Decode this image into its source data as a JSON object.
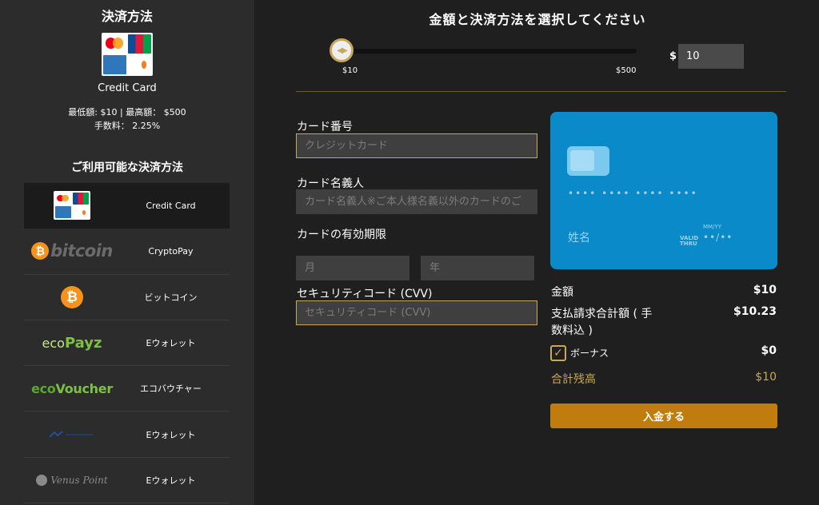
{
  "sidebar": {
    "title": "決済方法",
    "selected_name": "Credit Card",
    "limits": "最低額: $10 | 最高額： $500",
    "fee": "手数料： 2.25%",
    "available_title": "ご利用可能な決済方法",
    "methods": [
      {
        "label": "Credit Card",
        "logo": "credit-card-logos"
      },
      {
        "label": "CryptoPay",
        "logo": "bitcoin-wordmark"
      },
      {
        "label": "ビットコイン",
        "logo": "bitcoin-icon"
      },
      {
        "label": "Eウォレット",
        "logo": "ecopayz-logo",
        "logo_text": "ecoPayz"
      },
      {
        "label": "エコバウチャー",
        "logo": "ecovoucher-logo",
        "logo_text": "ecoVoucher"
      },
      {
        "label": "Eウォレット",
        "logo": "wallet-logo"
      },
      {
        "label": "Eウォレット",
        "logo": "venuspoint-logo",
        "logo_text": "Venus Point"
      }
    ]
  },
  "main": {
    "title": "金額と決済方法を選択してください",
    "slider": {
      "min_label": "$10",
      "max_label": "$500",
      "value_fraction": 0.0
    },
    "amount": {
      "currency": "$",
      "value": "10"
    }
  },
  "form": {
    "card_number_label": "カード番号",
    "card_number_placeholder": "クレジットカード",
    "card_holder_label": "カード名義人",
    "card_holder_placeholder": "カード名義人※ご本人様名義以外のカードのご",
    "expiry_label": "カードの有効期限",
    "month_placeholder": "月",
    "year_placeholder": "年",
    "cvv_label": "セキュリティコード (CVV)",
    "cvv_placeholder": "セキュリティコード (CVV)"
  },
  "card_preview": {
    "number": "•••• •••• •••• ••••",
    "name": "姓名",
    "valid_thru": "VALID THRU",
    "mmyy": "MM/YY",
    "expiry": "••/••",
    "color": "#0a8ac9"
  },
  "summary": {
    "amount_label": "金額",
    "amount_value": "$10",
    "total_label_1": "支払請求合計額 ( 手",
    "total_label_2": "数料込 )",
    "total_value": "$10.23",
    "bonus_label": "ボーナス",
    "bonus_value": "$0",
    "bonus_checked": true,
    "balance_label": "合計残高",
    "balance_value": "$10",
    "submit_label": "入金する"
  },
  "colors": {
    "accent": "#c9a75a",
    "button": "#c07d0e",
    "sidebar_bg": "#2c2c2c",
    "main_bg": "#1f1f1f"
  }
}
